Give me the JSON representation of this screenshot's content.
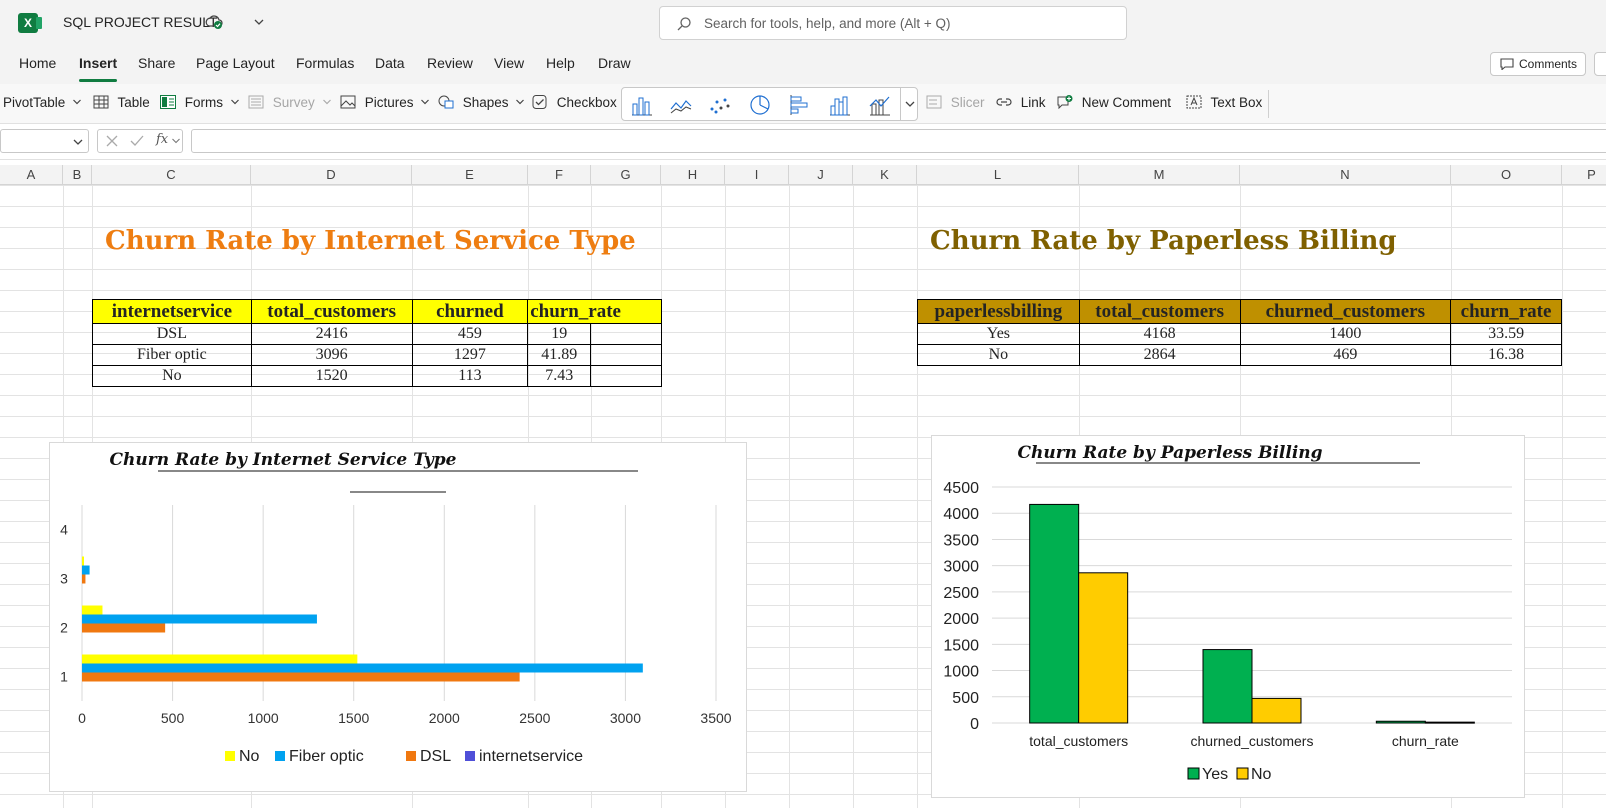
{
  "titlebar": {
    "doc_title": "SQL PROJECT RESULT",
    "search_placeholder": "Search for tools, help, and more (Alt + Q)"
  },
  "menu": {
    "tabs": [
      "Home",
      "Insert",
      "Share",
      "Page Layout",
      "Formulas",
      "Data",
      "Review",
      "View",
      "Help",
      "Draw"
    ],
    "active_tab": "Insert",
    "comments_label": "Comments"
  },
  "ribbon": {
    "pivottable": "PivotTable",
    "table": "Table",
    "forms": "Forms",
    "survey": "Survey",
    "pictures": "Pictures",
    "shapes": "Shapes",
    "checkbox": "Checkbox",
    "slicer": "Slicer",
    "link": "Link",
    "new_comment": "New Comment",
    "text_box": "Text Box"
  },
  "formula_bar": {
    "fx_label": "fx"
  },
  "columns": [
    "A",
    "B",
    "C",
    "D",
    "E",
    "F",
    "G",
    "H",
    "I",
    "J",
    "K",
    "L",
    "M",
    "N",
    "O",
    "P"
  ],
  "sheet": {
    "left_title": "Churn Rate by Internet Service Type",
    "right_title": "Churn Rate by Paperless Billing",
    "colors": {
      "left_title": "#ee7d11",
      "right_title": "#7f6000",
      "left_header_bg": "#ffff00",
      "right_header_bg": "#bf9000"
    },
    "internet_table": {
      "headers": [
        "internetservice",
        "total_customers",
        "churned",
        "churn_rate"
      ],
      "rows": [
        [
          "DSL",
          "2416",
          "459",
          "19"
        ],
        [
          "Fiber optic",
          "3096",
          "1297",
          "41.89"
        ],
        [
          "No",
          "1520",
          "113",
          "7.43"
        ]
      ]
    },
    "paperless_table": {
      "headers": [
        "paperlessbilling",
        "total_customers",
        "churned_customers",
        "churn_rate"
      ],
      "rows": [
        [
          "Yes",
          "4168",
          "1400",
          "33.59"
        ],
        [
          "No",
          "2864",
          "469",
          "16.38"
        ]
      ]
    }
  },
  "chart_data": [
    {
      "type": "bar",
      "orientation": "horizontal",
      "title": "Churn Rate by Internet Service Type",
      "categories": [
        "1",
        "2",
        "3",
        "4"
      ],
      "series": [
        {
          "name": "No",
          "color": "#ffff00",
          "values": [
            1520,
            113,
            7.43,
            0
          ]
        },
        {
          "name": "Fiber optic",
          "color": "#00a2f0",
          "values": [
            3096,
            1297,
            41.89,
            0
          ]
        },
        {
          "name": "DSL",
          "color": "#f07810",
          "values": [
            2416,
            459,
            19,
            0
          ]
        },
        {
          "name": "internetservice",
          "color": "#4f4fd8",
          "values": [
            0,
            0,
            0,
            0
          ]
        }
      ],
      "xlim": [
        0,
        3500
      ],
      "xticks": [
        "0",
        "500",
        "1000",
        "1500",
        "2000",
        "2500",
        "3000",
        "3500"
      ],
      "grid": true,
      "legend": "bottom"
    },
    {
      "type": "bar",
      "title": "Churn Rate by Paperless Billing",
      "categories": [
        "total_customers",
        "churned_customers",
        "churn_rate"
      ],
      "series": [
        {
          "name": "Yes",
          "color": "#00b050",
          "values": [
            4168,
            1400,
            33.59
          ]
        },
        {
          "name": "No",
          "color": "#ffcc00",
          "values": [
            2864,
            469,
            16.38
          ]
        }
      ],
      "ylim": [
        0,
        4500
      ],
      "yticks": [
        "0",
        "500",
        "1000",
        "1500",
        "2000",
        "2500",
        "3000",
        "3500",
        "4000",
        "4500"
      ],
      "grid": true,
      "legend": "bottom"
    }
  ]
}
